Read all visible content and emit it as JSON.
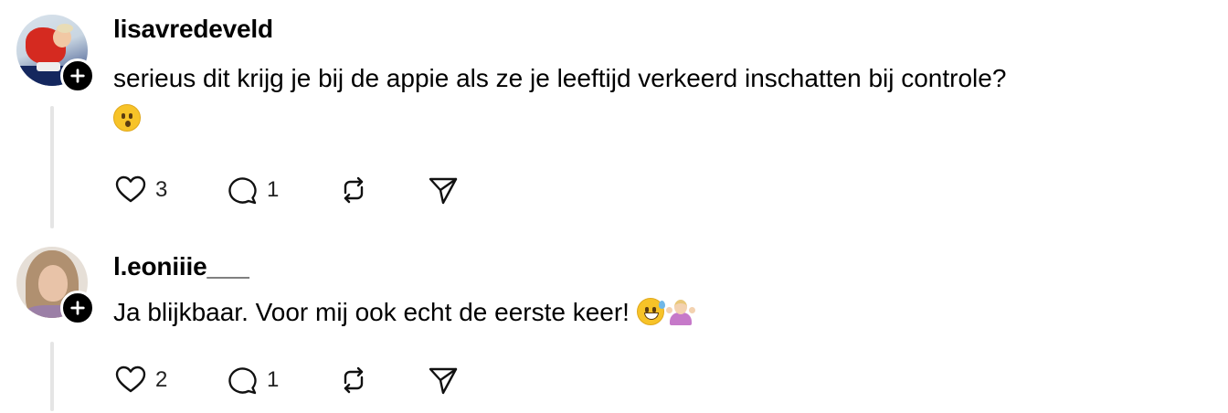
{
  "comments": [
    {
      "username": "lisavredeveld",
      "text": "serieus dit krijg je bij de appie als ze je leeftijd verkeerd inschatten bij controle?",
      "emojis": [
        "hushed-face"
      ],
      "likes": "3",
      "replies": "1"
    },
    {
      "username": "l.eoniiie___",
      "text": "Ja blijkbaar. Voor mij ook echt de eerste keer! ",
      "emojis": [
        "grinning-face-with-sweat",
        "person-shrugging"
      ],
      "likes": "2",
      "replies": "1"
    }
  ],
  "icons": {
    "follow": "plus-icon",
    "like": "heart-icon",
    "reply": "comment-icon",
    "repost": "repost-icon",
    "share": "send-icon"
  },
  "colors": {
    "text": "#000000",
    "thread_line": "#e5e5e5",
    "badge": "#000000"
  }
}
